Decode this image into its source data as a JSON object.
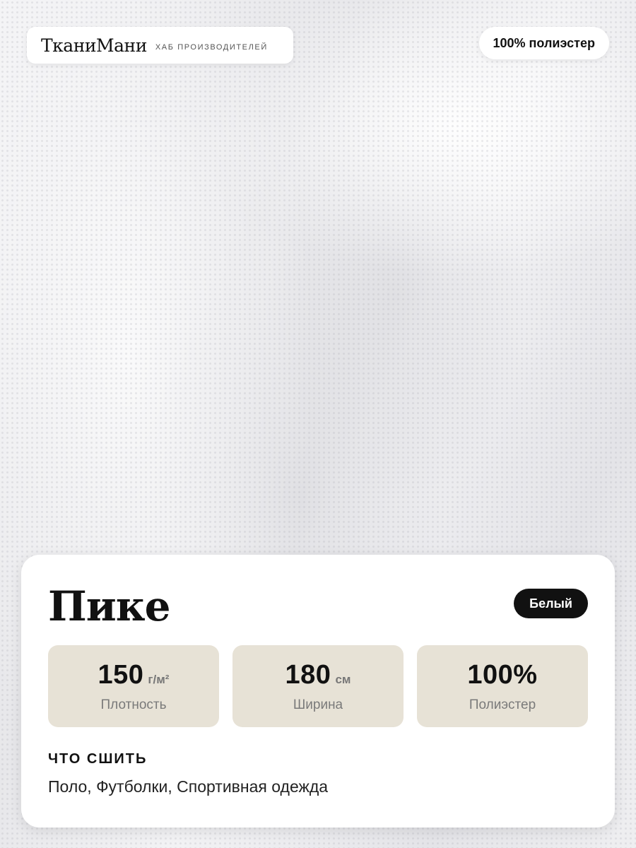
{
  "brand": {
    "name": "ТканиМани",
    "subtitle": "ХАБ ПРОИЗВОДИТЕЛЕЙ"
  },
  "composition_badge": "100% полиэстер",
  "product": {
    "title": "Пике",
    "color_badge": "Белый",
    "stats": [
      {
        "value": "150",
        "unit": "г/м²",
        "label": "Плотность"
      },
      {
        "value": "180",
        "unit": "см",
        "label": "Ширина"
      },
      {
        "value": "100%",
        "unit": "",
        "label": "Полиэстер"
      }
    ],
    "use_heading": "ЧТО СШИТЬ",
    "use_text": "Поло, Футболки, Спортивная одежда"
  },
  "colors": {
    "card_bg": "#ffffff",
    "stat_bg": "#e7e2d6",
    "badge_bg": "#111111",
    "fabric": "#ececee"
  }
}
